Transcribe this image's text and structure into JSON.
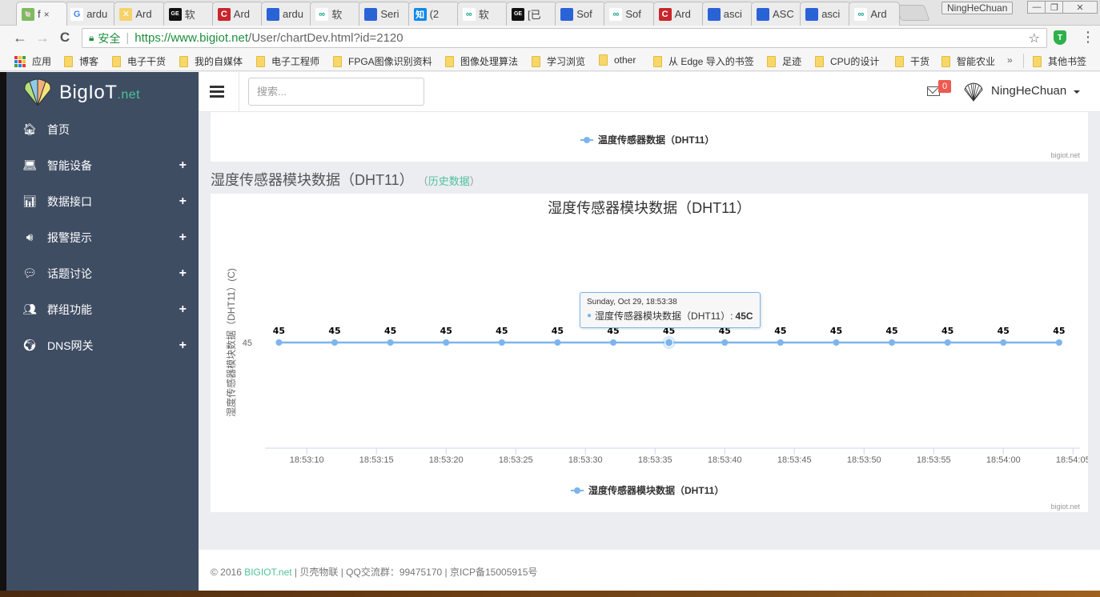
{
  "browser": {
    "tabs": [
      {
        "label": "f",
        "icon": "bigiot-shell-icon",
        "active": true
      },
      {
        "label": "ardu",
        "icon": "google-icon"
      },
      {
        "label": "Ard",
        "icon": "arduino-icon"
      },
      {
        "label": "软 ",
        "icon": "geek-icon"
      },
      {
        "label": "Ard",
        "icon": "csdn-icon"
      },
      {
        "label": "ardu",
        "icon": "baidu-icon"
      },
      {
        "label": "软 ",
        "icon": "infinity-icon"
      },
      {
        "label": "Seri",
        "icon": "baidu-icon"
      },
      {
        "label": "(2 ",
        "icon": "zhihu-icon"
      },
      {
        "label": "软 ",
        "icon": "infinity-icon"
      },
      {
        "label": "[已",
        "icon": "geek-icon"
      },
      {
        "label": "Sof",
        "icon": "baidu-icon"
      },
      {
        "label": "Sof",
        "icon": "infinity-icon"
      },
      {
        "label": "Ard",
        "icon": "csdn-icon"
      },
      {
        "label": "asci",
        "icon": "baidu-icon"
      },
      {
        "label": "ASC",
        "icon": "baidu-icon"
      },
      {
        "label": "asci",
        "icon": "baidu-icon"
      },
      {
        "label": "Ard",
        "icon": "infinity-icon"
      }
    ],
    "tab_close": "×",
    "profile_name": "NingHeChuan",
    "window_controls": {
      "minimize": "—",
      "restore": "❐",
      "close": "✕"
    },
    "nav": {
      "back": "←",
      "forward": "→",
      "reload": "C"
    },
    "address": {
      "secure_label": "安全",
      "url_scheme_host": "https://www.bigiot.net",
      "url_path": "/User/chartDev.html?id=2120"
    },
    "extension_badge": "T",
    "bookmarks": [
      {
        "label": "应用",
        "type": "apps"
      },
      {
        "label": "博客"
      },
      {
        "label": "电子干货"
      },
      {
        "label": "我的自媒体"
      },
      {
        "label": "电子工程师"
      },
      {
        "label": "FPGA图像识别资料"
      },
      {
        "label": "图像处理算法"
      },
      {
        "label": "学习浏览"
      },
      {
        "label": "other"
      },
      {
        "label": "从 Edge 导入的书签"
      },
      {
        "label": "足迹"
      },
      {
        "label": "CPU的设计"
      },
      {
        "label": "干货"
      },
      {
        "label": "智能农业"
      }
    ],
    "bookmarks_overflow": "»",
    "other_bookmarks": "其他书签"
  },
  "app": {
    "logo_text": "BigIoT",
    "logo_suffix": ".net",
    "sidebar": [
      {
        "label": "首页",
        "icon": "home-icon",
        "expandable": false
      },
      {
        "label": "智能设备",
        "icon": "laptop-icon",
        "expandable": true
      },
      {
        "label": "数据接口",
        "icon": "bar-chart-icon",
        "expandable": true
      },
      {
        "label": "报警提示",
        "icon": "volume-icon",
        "expandable": true
      },
      {
        "label": "话题讨论",
        "icon": "comments-icon",
        "expandable": true
      },
      {
        "label": "群组功能",
        "icon": "users-icon",
        "expandable": true
      },
      {
        "label": "DNS网关",
        "icon": "globe-icon",
        "expandable": true
      }
    ],
    "expand_symbol": "+",
    "search_placeholder": "搜索...",
    "mail_count": "0",
    "username": "NingHeChuan"
  },
  "prev_chart": {
    "legend": "温度传感器数据（DHT11）",
    "credit": "bigiot.net"
  },
  "section": {
    "title": "湿度传感器模块数据（DHT11）",
    "history_open": "（",
    "history_link": "历史数据",
    "history_close": "）"
  },
  "chart_data": {
    "type": "line",
    "title": "湿度传感器模块数据（DHT11）",
    "xlabel": "",
    "ylabel": "湿度传感器模块数据（DHT11）(C)",
    "x": [
      "18:53:08",
      "18:53:12",
      "18:53:16",
      "18:53:20",
      "18:53:24",
      "18:53:28",
      "18:53:32",
      "18:53:38",
      "18:53:40",
      "18:53:44",
      "18:53:48",
      "18:53:52",
      "18:53:56",
      "18:54:00",
      "18:54:04"
    ],
    "x_seconds": [
      0,
      4,
      8,
      12,
      16,
      20,
      24,
      28,
      32,
      36,
      40,
      44,
      48,
      52,
      56
    ],
    "xticks": [
      "18:53:10",
      "18:53:15",
      "18:53:20",
      "18:53:25",
      "18:53:30",
      "18:53:35",
      "18:53:40",
      "18:53:45",
      "18:53:50",
      "18:53:55",
      "18:54:00",
      "18:54:05"
    ],
    "yticks": [
      "45"
    ],
    "series": [
      {
        "name": "湿度传感器模块数据（DHT11）",
        "color": "#7cb5ec",
        "values": [
          45,
          45,
          45,
          45,
          45,
          45,
          45,
          45,
          45,
          45,
          45,
          45,
          45,
          45,
          45
        ]
      }
    ],
    "data_labels": true,
    "legend_position": "bottom-center",
    "hovered_index": 7,
    "tooltip": {
      "date": "Sunday, Oct 29, 18:53:38",
      "series": "湿度传感器模块数据（DHT11）",
      "value": "45C"
    },
    "credit": "bigiot.net"
  },
  "footer": {
    "copyright": "© 2016 ",
    "brand_link": "BIGIOT.net",
    "rest": " | 贝壳物联 | QQ交流群：99475170 | 京ICP备15005915号"
  }
}
